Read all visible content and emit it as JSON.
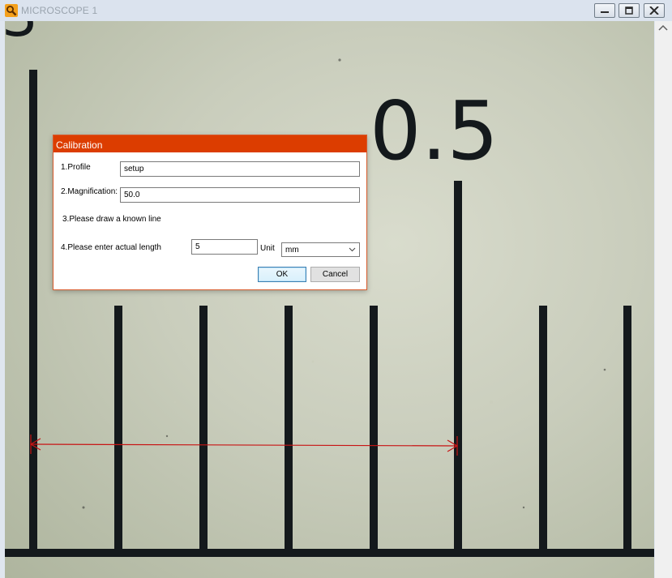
{
  "window": {
    "title": "MICROSCOPE 1",
    "icon": "magnifier-icon",
    "controls": [
      "minimize-icon",
      "restore-icon",
      "close-icon"
    ]
  },
  "image": {
    "scale_label": "0.5",
    "partial_label": "3",
    "measurement_line_color": "#c81414"
  },
  "dialog": {
    "title": "Calibration",
    "accent_color": "#dc3d00",
    "profile_label": "1.Profile",
    "profile_value": "setup",
    "magnification_label": "2.Magnification:",
    "magnification_value": "50.0",
    "draw_instruction": "3.Please draw a known line",
    "length_label": "4.Please enter actual length",
    "length_value": "5",
    "unit_label": "Unit",
    "unit_value": "mm",
    "ok_label": "OK",
    "cancel_label": "Cancel"
  }
}
